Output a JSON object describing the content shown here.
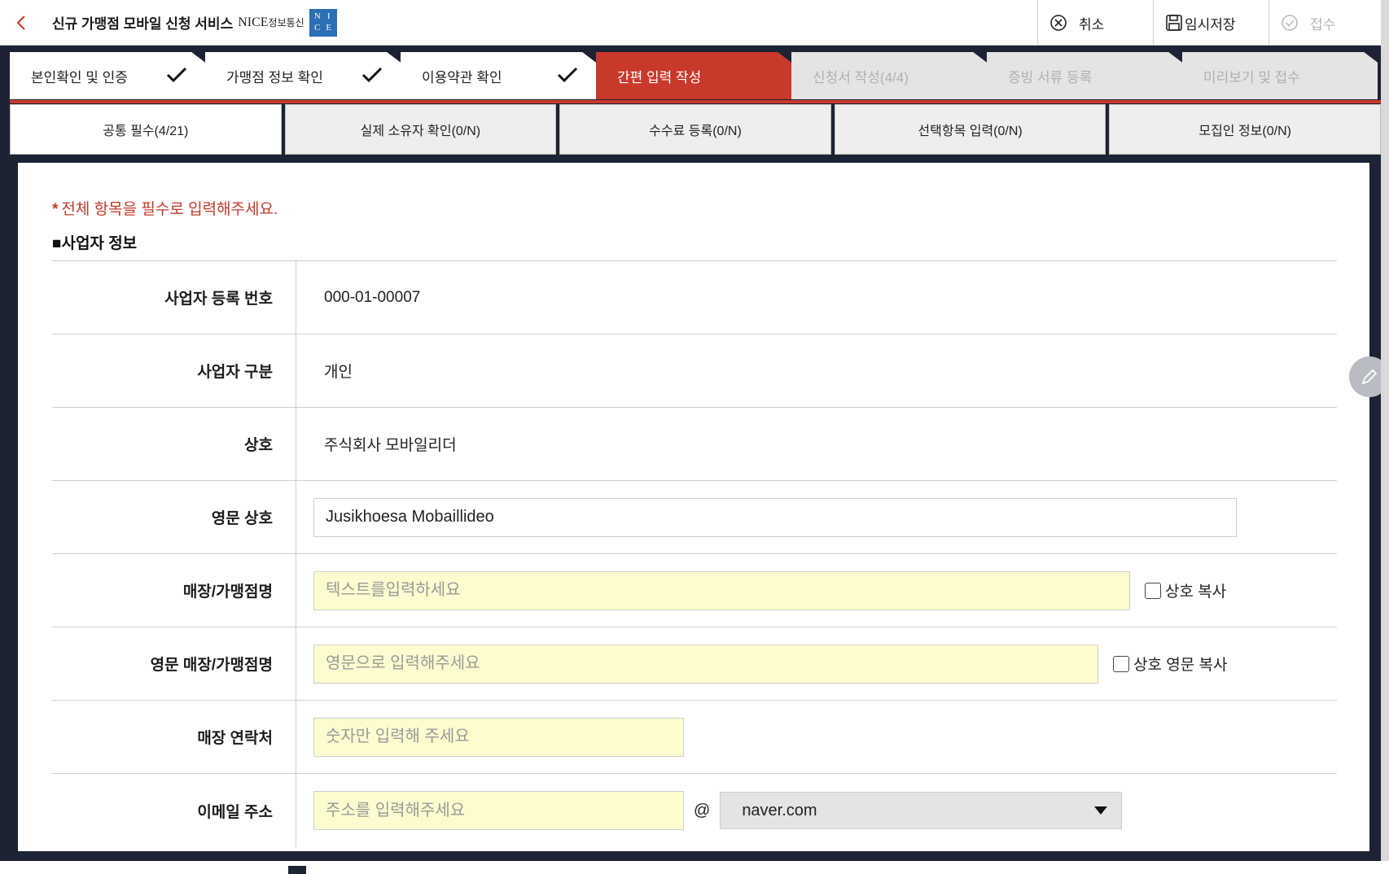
{
  "header": {
    "back_icon": "chevron-left-icon",
    "title": "신규 가맹점 모바일 신청 서비스",
    "brand_name": "NICE",
    "brand_sub": "정보통신",
    "brand_logo_letters": [
      "N",
      "I",
      "C",
      "E"
    ],
    "actions": [
      {
        "label": "취소",
        "icon": "cancel-circle-icon",
        "enabled": true
      },
      {
        "label": "임시저장",
        "icon": "save-icon",
        "enabled": true
      },
      {
        "label": "접수",
        "icon": "check-circle-icon",
        "enabled": false
      }
    ]
  },
  "steps": [
    {
      "label": "본인확인 및 인증",
      "state": "done"
    },
    {
      "label": "가맹점 정보 확인",
      "state": "done"
    },
    {
      "label": "이용약관 확인",
      "state": "done"
    },
    {
      "label": "간편 입력 작성",
      "state": "active"
    },
    {
      "label": "신청서 작성(4/4)",
      "state": "inactive"
    },
    {
      "label": "증빙 서류 등록",
      "state": "inactive"
    },
    {
      "label": "미리보기 및 접수",
      "state": "inactive"
    }
  ],
  "subtabs": [
    {
      "label": "공통 필수(4/21)",
      "active": true
    },
    {
      "label": "실제 소유자 확인(0/N)",
      "active": false
    },
    {
      "label": "수수료 등록(0/N)",
      "active": false
    },
    {
      "label": "선택항목 입력(0/N)",
      "active": false
    },
    {
      "label": "모집인 정보(0/N)",
      "active": false
    }
  ],
  "notice": {
    "star": "*",
    "text": "전체 항목을 필수로 입력해주세요."
  },
  "section_title": "■사업자 정보",
  "form": {
    "biz_number": {
      "label": "사업자 등록 번호",
      "value": "000-01-00007"
    },
    "biz_type": {
      "label": "사업자 구분",
      "value": "개인"
    },
    "company_name": {
      "label": "상호",
      "value": "주식회사 모바일리더"
    },
    "company_name_en": {
      "label": "영문 상호",
      "value": "Jusikhoesa Mobaillideo"
    },
    "store_name": {
      "label": "매장/가맹점명",
      "value": "",
      "placeholder": "텍스트를입력하세요",
      "copy_label": "상호 복사"
    },
    "store_name_en": {
      "label": "영문 매장/가맹점명",
      "value": "",
      "placeholder": "영문으로 입력해주세요",
      "copy_label": "상호 영문 복사"
    },
    "store_phone": {
      "label": "매장 연락처",
      "value": "",
      "placeholder": "숫자만 입력해 주세요"
    },
    "email": {
      "label": "이메일 주소",
      "value": "",
      "placeholder": "주소를 입력해주세요",
      "at": "@",
      "domain": "naver.com"
    }
  },
  "colors": {
    "accent": "#c8392b",
    "required_field_bg": "#fdfccf",
    "frame": "#1c2333"
  }
}
